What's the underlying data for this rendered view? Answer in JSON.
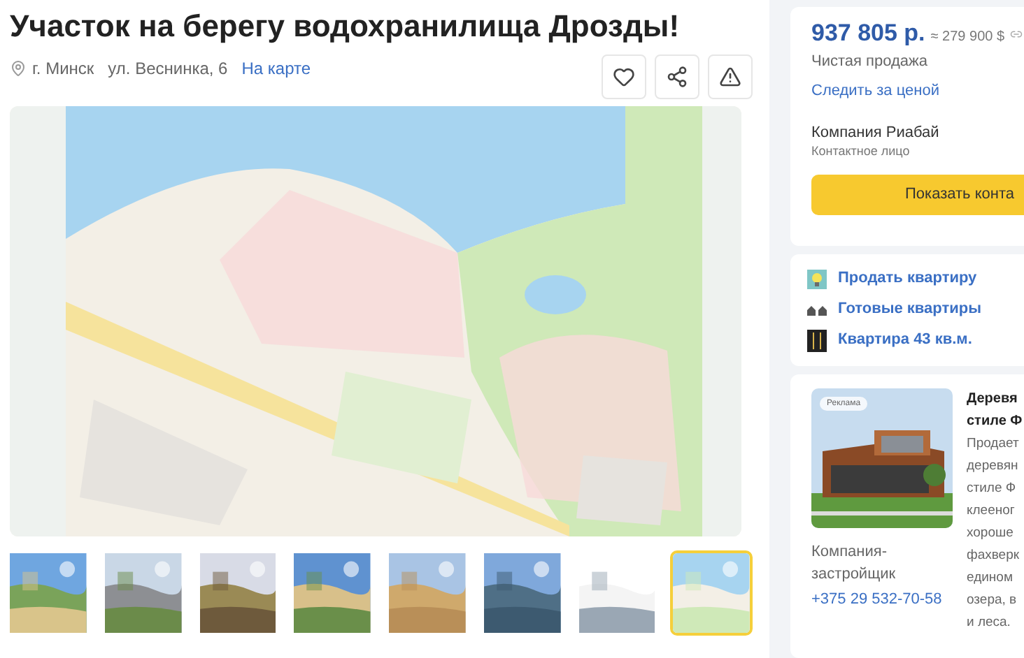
{
  "title": "Участок на берегу водохранилища Дрозды!",
  "location": {
    "city": "г. Минск",
    "street": "ул. Веснинка, 6",
    "map_link": "На карте"
  },
  "gallery": {
    "main": {
      "kind": "picture"
    },
    "thumbnails": [
      {
        "kind": "picture",
        "selected": false
      },
      {
        "kind": "picture",
        "selected": false
      },
      {
        "kind": "picture",
        "selected": false
      },
      {
        "kind": "picture",
        "selected": false
      },
      {
        "kind": "picture",
        "selected": false
      },
      {
        "kind": "picture",
        "selected": false
      },
      {
        "kind": "picture",
        "selected": false
      },
      {
        "kind": "picture",
        "selected": true
      }
    ]
  },
  "price": {
    "main": "937 805 р.",
    "approx": "≈ 279 900 $",
    "deal": "Чистая продажа",
    "watch_link": "Следить за ценой"
  },
  "seller": {
    "name": "Компания Риабай",
    "role": "Контактное лицо",
    "button": "Показать конта"
  },
  "links": [
    {
      "kind": "bulb",
      "label": "Продать квартиру"
    },
    {
      "kind": "houses",
      "label": "Готовые квартиры"
    },
    {
      "kind": "building",
      "label": "Квартира 43 кв.м."
    }
  ],
  "ad": {
    "badge": "Реклама",
    "company": "Компания-застройщик",
    "phone": "+375 29 532-70-58",
    "title_lines": [
      "Деревя",
      "стиле Ф"
    ],
    "text_lines": [
      "Продает",
      "деревян",
      "стиле Ф",
      "клееног",
      "хороше",
      "фахверк",
      "едином",
      "озера, в",
      "и леса."
    ]
  }
}
